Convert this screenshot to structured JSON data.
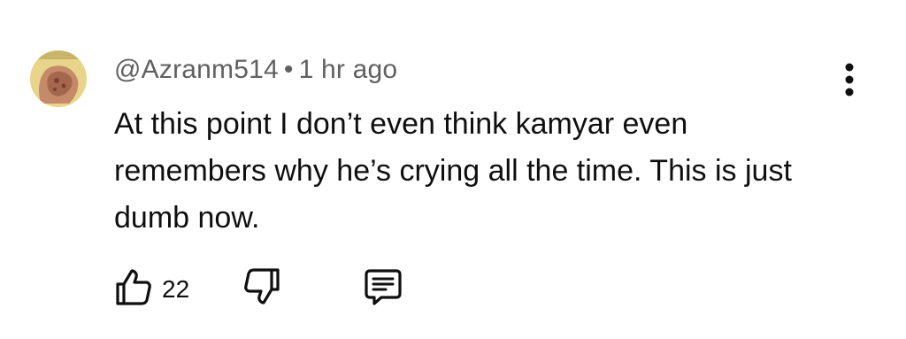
{
  "comment": {
    "author": "@Azranm514",
    "separator": "•",
    "time": "1 hr ago",
    "text": "At this point I don’t even think kamyar even remembers why he’s crying all the time. This is just dumb now.",
    "like_count": "22"
  },
  "icons": {
    "avatar": "hand-avatar",
    "menu": "more-vertical-icon",
    "like": "thumbs-up-icon",
    "dislike": "thumbs-down-icon",
    "reply": "reply-comment-icon"
  },
  "colors": {
    "text": "#0f0f0f",
    "meta": "#606060",
    "avatar_bg": "#e8d48a"
  }
}
